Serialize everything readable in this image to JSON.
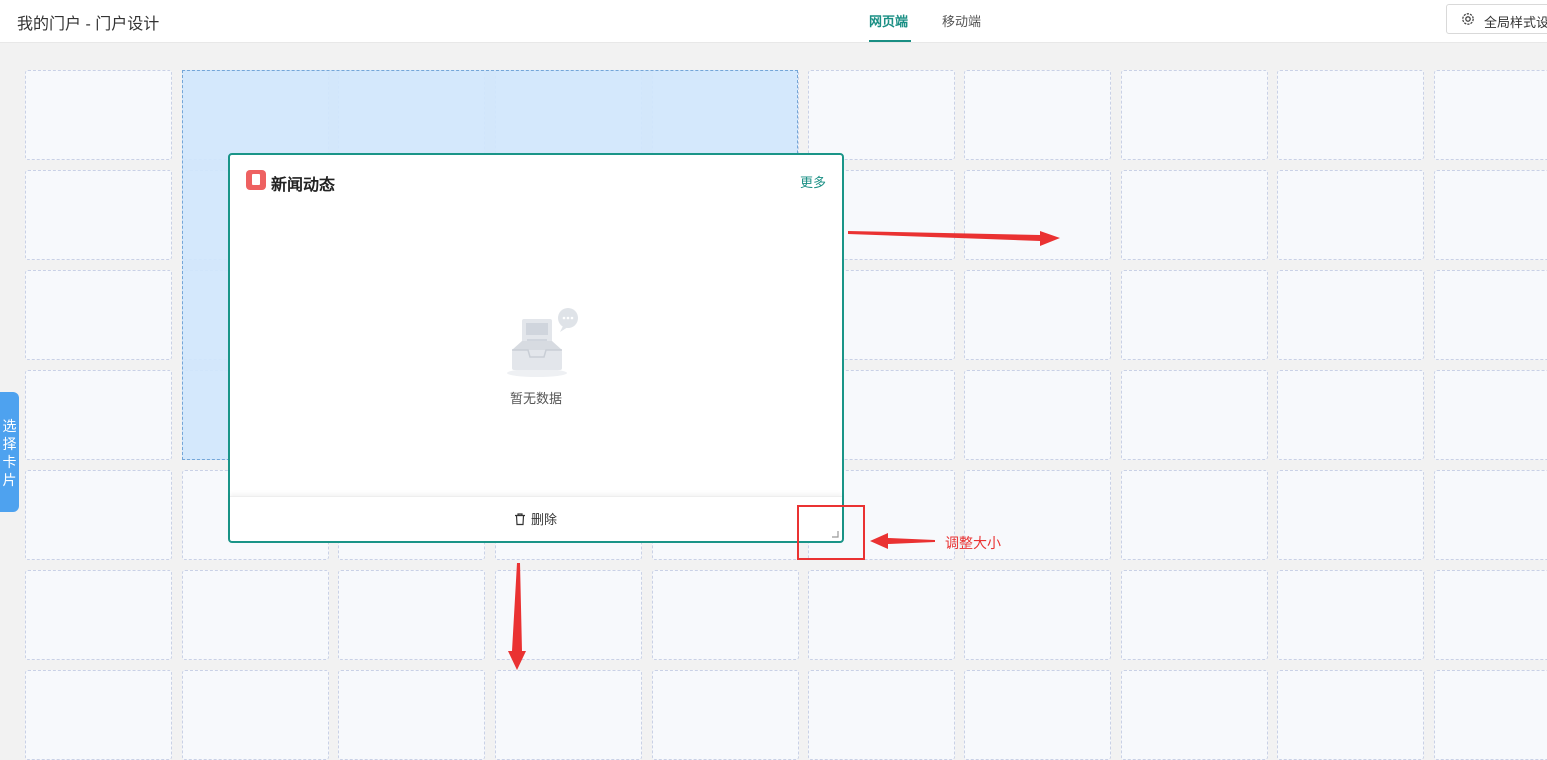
{
  "header": {
    "title": "我的门户 - 门户设计",
    "tabs": [
      {
        "label": "网页端",
        "active": true
      },
      {
        "label": "移动端",
        "active": false
      }
    ],
    "global_style_button": "全局样式设"
  },
  "card": {
    "title": "新闻动态",
    "more_label": "更多",
    "empty_text": "暂无数据",
    "delete_label": "删除"
  },
  "side_tab": {
    "label": "选择卡片"
  },
  "annotation": {
    "label": "调整大小"
  },
  "colors": {
    "accent": "#1a8f84",
    "card_border": "#1a9588",
    "selection_fill": "#d1e6fc",
    "annotation": "#ea3232",
    "side_tab": "#4ea2ef",
    "card_icon": "#ee6161"
  }
}
